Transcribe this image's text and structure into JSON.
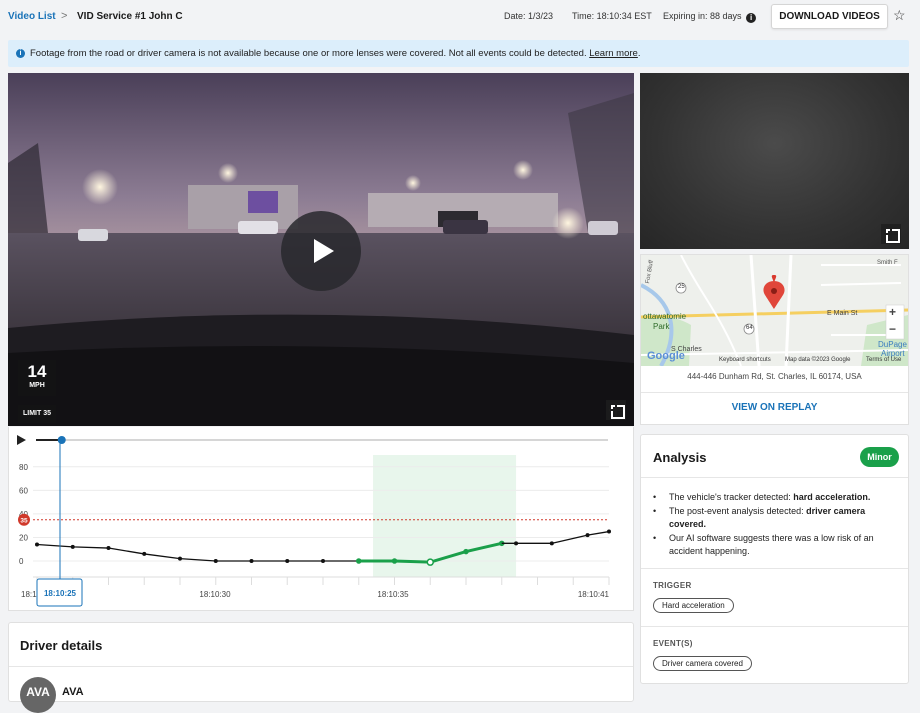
{
  "breadcrumb": {
    "link": "Video List",
    "separator": ">",
    "current": "VID Service #1 John C"
  },
  "meta": {
    "date": "Date: 1/3/23",
    "time": "Time: 18:10:34 EST",
    "expiring": "Expiring in: 88 days",
    "info_icon": "i"
  },
  "actions": {
    "download": "DOWNLOAD VIDEOS",
    "star_icon": "star-outline"
  },
  "banner": {
    "text": "Footage from the road or driver camera is not available because one or more lenses were covered. Not all events could be detected.",
    "link": "Learn more",
    "link_tail": "."
  },
  "video": {
    "speed": "14",
    "speed_unit": "MPH",
    "limit": "LIMIT 35",
    "playback_progress": 0.045
  },
  "map": {
    "labels": {
      "hwy25": "25",
      "hwy64": "64",
      "pottawatomie": "ottawatomie",
      "park": "Park",
      "charles": "S Charles",
      "main": "E Main St",
      "dupage": "DuPage",
      "airport": "Airport",
      "google": "Google",
      "shortcuts": "Keyboard shortcuts",
      "mapdata": "Map data ©2023 Google",
      "terms": "Terms of Use",
      "zoom_in": "+",
      "zoom_out": "−",
      "fox": "Fox Bluff",
      "smith": "Smith F"
    },
    "address": "444-446 Dunham Rd, St. Charles, IL 60174, USA",
    "replay": "VIEW ON REPLAY"
  },
  "analysis": {
    "title": "Analysis",
    "badge": "Minor",
    "bullets": [
      {
        "pre": "The vehicle's tracker detected: ",
        "bold": "hard acceleration."
      },
      {
        "pre": "The post-event analysis detected: ",
        "bold": "driver camera covered."
      },
      {
        "pre": "Our AI software suggests there was a low risk of an accident happening.",
        "bold": ""
      }
    ],
    "trigger_label": "TRIGGER",
    "trigger_value": "Hard acceleration",
    "events_label": "EVENT(S)",
    "events_value": "Driver camera covered"
  },
  "driver": {
    "title": "Driver details",
    "initials": "AVA",
    "name": "AVA"
  },
  "colors": {
    "accent": "#1a73b8",
    "speed_line": "#111111",
    "event_line": "#1aa04a",
    "event_band": "#e8f6ec",
    "limit_line": "#d0392b",
    "badge": "#1aa04a"
  },
  "chart_data": {
    "type": "line",
    "ylim": [
      0,
      90
    ],
    "yticks": [
      "0",
      "20",
      "40",
      "60",
      "80"
    ],
    "speed_limit": 35,
    "speed_limit_label": "35",
    "x_tick_labels": [
      "18:10",
      "18:10:30",
      "18:10:35",
      "18:10:41"
    ],
    "cursor_label": "18:10:25",
    "event_window": [
      17,
      21
    ],
    "x": [
      0,
      1,
      2,
      3,
      4,
      5,
      6,
      7,
      8,
      9,
      10,
      11,
      12,
      13,
      14,
      15,
      16
    ],
    "series": [
      {
        "values": [
          14,
          12,
          11,
          6,
          2,
          0,
          0,
          0,
          0,
          0,
          0,
          0,
          0,
          0,
          0,
          0,
          0
        ]
      }
    ],
    "event_series": [
      {
        "x": [
          10,
          11,
          12,
          13,
          14,
          15,
          16
        ],
        "values": [
          0,
          0,
          -1,
          8,
          15,
          15,
          22
        ]
      }
    ],
    "tail": {
      "x": [
        15,
        16,
        17
      ],
      "values": [
        15,
        22,
        25
      ]
    }
  }
}
